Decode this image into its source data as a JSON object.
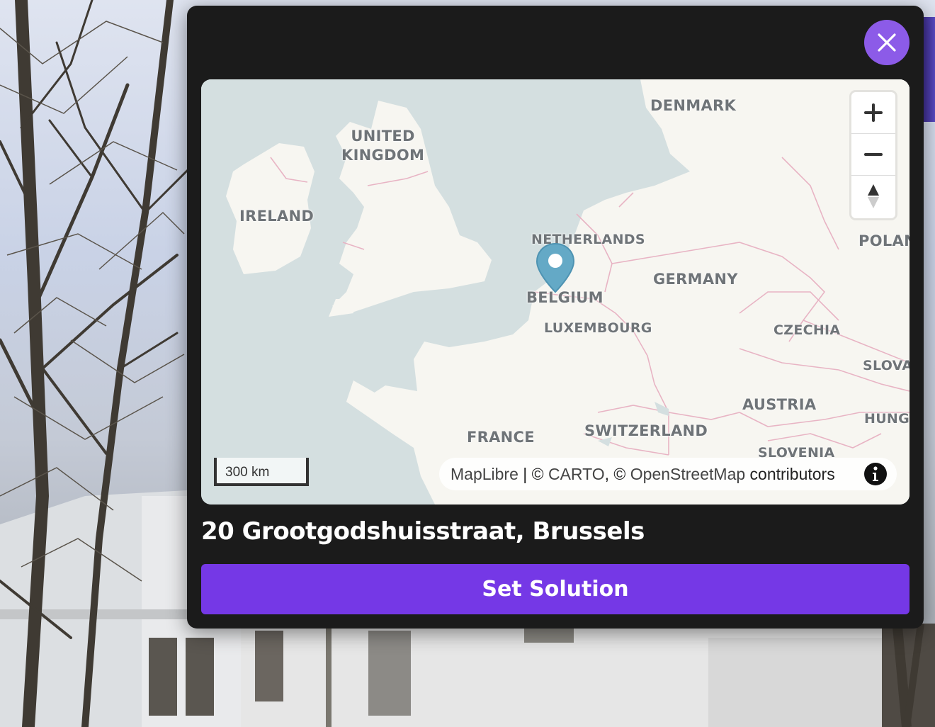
{
  "modal": {
    "close_icon": "close-icon",
    "address": "20 Grootgodshuisstraat, Brussels",
    "set_solution_label": "Set Solution"
  },
  "map": {
    "labels": {
      "denmark": "DENMARK",
      "uk_line1": "UNITED",
      "uk_line2": "KINGDOM",
      "ireland": "IRELAND",
      "netherlands": "NETHERLANDS",
      "belgium": "BELGIUM",
      "germany": "GERMANY",
      "poland": "POLAN",
      "luxembourg": "LUXEMBOURG",
      "czechia": "CZECHIA",
      "slovakia": "SLOVA",
      "austria": "AUSTRIA",
      "hungary": "HUNG",
      "france": "FRANCE",
      "switzerland": "SWITZERLAND",
      "slovenia": "SLOVENIA"
    },
    "scale_label": "300 km",
    "attribution": {
      "maplibre": "MapLibre",
      "separator": " | © ",
      "carto": "CARTO",
      "comma": ", © ",
      "osm": "OpenStreetMap",
      "contributors": " contributors"
    },
    "controls": {
      "zoom_in_icon": "plus-icon",
      "zoom_out_icon": "minus-icon",
      "compass_icon": "compass-icon",
      "info_icon": "info-icon"
    },
    "marker_icon": "map-pin-icon",
    "colors": {
      "water": "#d4dfe0",
      "land": "#f7f6f1",
      "border": "#e8b4c4",
      "marker": "#64a9c6"
    }
  },
  "colors": {
    "accent": "#7538e6",
    "close_button": "#8c5be8",
    "modal_bg": "#1b1b1b"
  }
}
